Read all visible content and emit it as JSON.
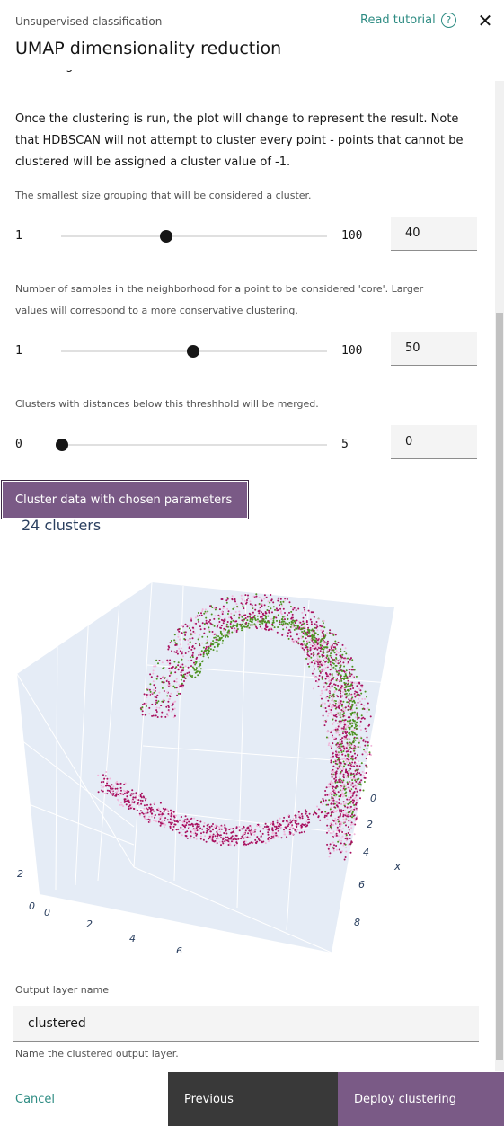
{
  "header": {
    "kicker": "Unsupervised classification",
    "title": "UMAP dimensionality reduction",
    "tutorial_label": "Read tutorial",
    "help_icon": "question-circle-icon",
    "close_icon": "close-icon"
  },
  "intro": {
    "cut_line": "clusterings.",
    "paragraph": "Once the clustering is run, the plot will change to represent the result. Note that HDBSCAN will not attempt to cluster every point - points that cannot be clustered will be assigned a cluster value of -1."
  },
  "params": [
    {
      "help": "The smallest size grouping that will be considered a cluster.",
      "min": "1",
      "max": "100",
      "value": "40",
      "fraction": 0.39
    },
    {
      "help": "Number of samples in the neighborhood for a point to be considered 'core'. Larger values will correspond to a more conservative clustering.",
      "min": "1",
      "max": "100",
      "value": "50",
      "fraction": 0.49
    },
    {
      "help": "Clusters with distances below this threshhold will be merged.",
      "min": "0",
      "max": "5",
      "value": "0",
      "fraction": 0.0
    }
  ],
  "cluster_button": "Cluster data with chosen parameters",
  "result": {
    "clusters_text": "24 clusters"
  },
  "plot": {
    "x_axis_title": "x",
    "x_ticks": [
      "0",
      "2",
      "4",
      "6",
      "8"
    ],
    "left_ticks": [
      "2",
      "0",
      "0",
      "2",
      "4",
      "6"
    ],
    "colors": {
      "magenta": "#a8105f",
      "pink": "#f1b6da",
      "green": "#4d9221",
      "scene_bg": "#e5ecf6"
    }
  },
  "output": {
    "label": "Output layer name",
    "value": "clustered",
    "help": "Name the clustered output layer."
  },
  "footer": {
    "cancel": "Cancel",
    "previous": "Previous",
    "deploy": "Deploy clustering"
  },
  "colors": {
    "accent": "#7a5a86",
    "link": "#2e8c83",
    "dark_button": "#393939"
  }
}
